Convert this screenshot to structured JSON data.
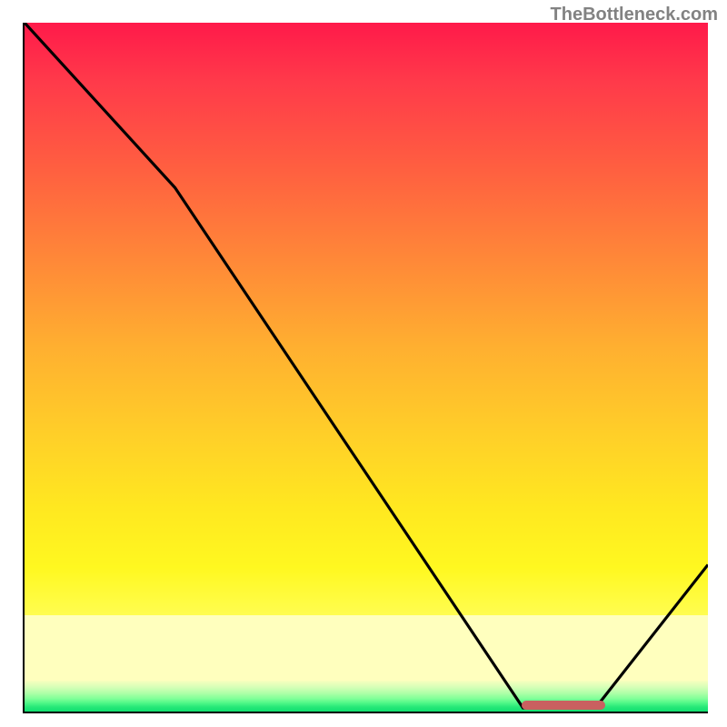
{
  "watermark": "TheBottleneck.com",
  "chart_data": {
    "type": "line",
    "title": "",
    "xlabel": "",
    "ylabel": "",
    "x": [
      0,
      22,
      73,
      83,
      100
    ],
    "values": [
      100,
      76,
      0,
      0,
      21
    ],
    "ylim": [
      0,
      100
    ],
    "xlim": [
      0,
      100
    ],
    "marker": {
      "x_start": 73,
      "x_end": 85,
      "y": 0.3
    },
    "background": "gradient red-yellow-green"
  }
}
